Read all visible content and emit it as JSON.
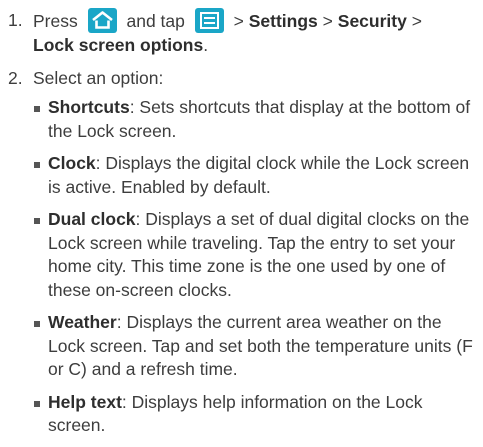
{
  "steps": [
    {
      "number": "1.",
      "press": "Press",
      "and_tap": "and tap",
      "sep1": ">",
      "settings": "Settings",
      "sep2": ">",
      "security": "Security",
      "sep3": ">",
      "lock_screen_options": "Lock screen options",
      "end": "."
    },
    {
      "number": "2.",
      "text": "Select an option:"
    }
  ],
  "icons": {
    "home": "home-icon",
    "menu": "menu-icon",
    "accent": "#1aa6c7"
  },
  "options": [
    {
      "title": "Shortcuts",
      "desc": ": Sets shortcuts that display at the bottom of the Lock screen."
    },
    {
      "title": "Clock",
      "desc": ": Displays the digital clock while the Lock screen is active. Enabled by default."
    },
    {
      "title": "Dual clock",
      "desc": ": Displays a set of dual digital clocks on the Lock screen while traveling. Tap the entry to set your home city. This time zone is the one used by one of these on-screen clocks."
    },
    {
      "title": "Weather",
      "desc": ": Displays the current area weather on the Lock screen. Tap and set both the temperature units (F or C) and a refresh time."
    },
    {
      "title": "Help text",
      "desc": ": Displays help information on the Lock screen."
    }
  ]
}
